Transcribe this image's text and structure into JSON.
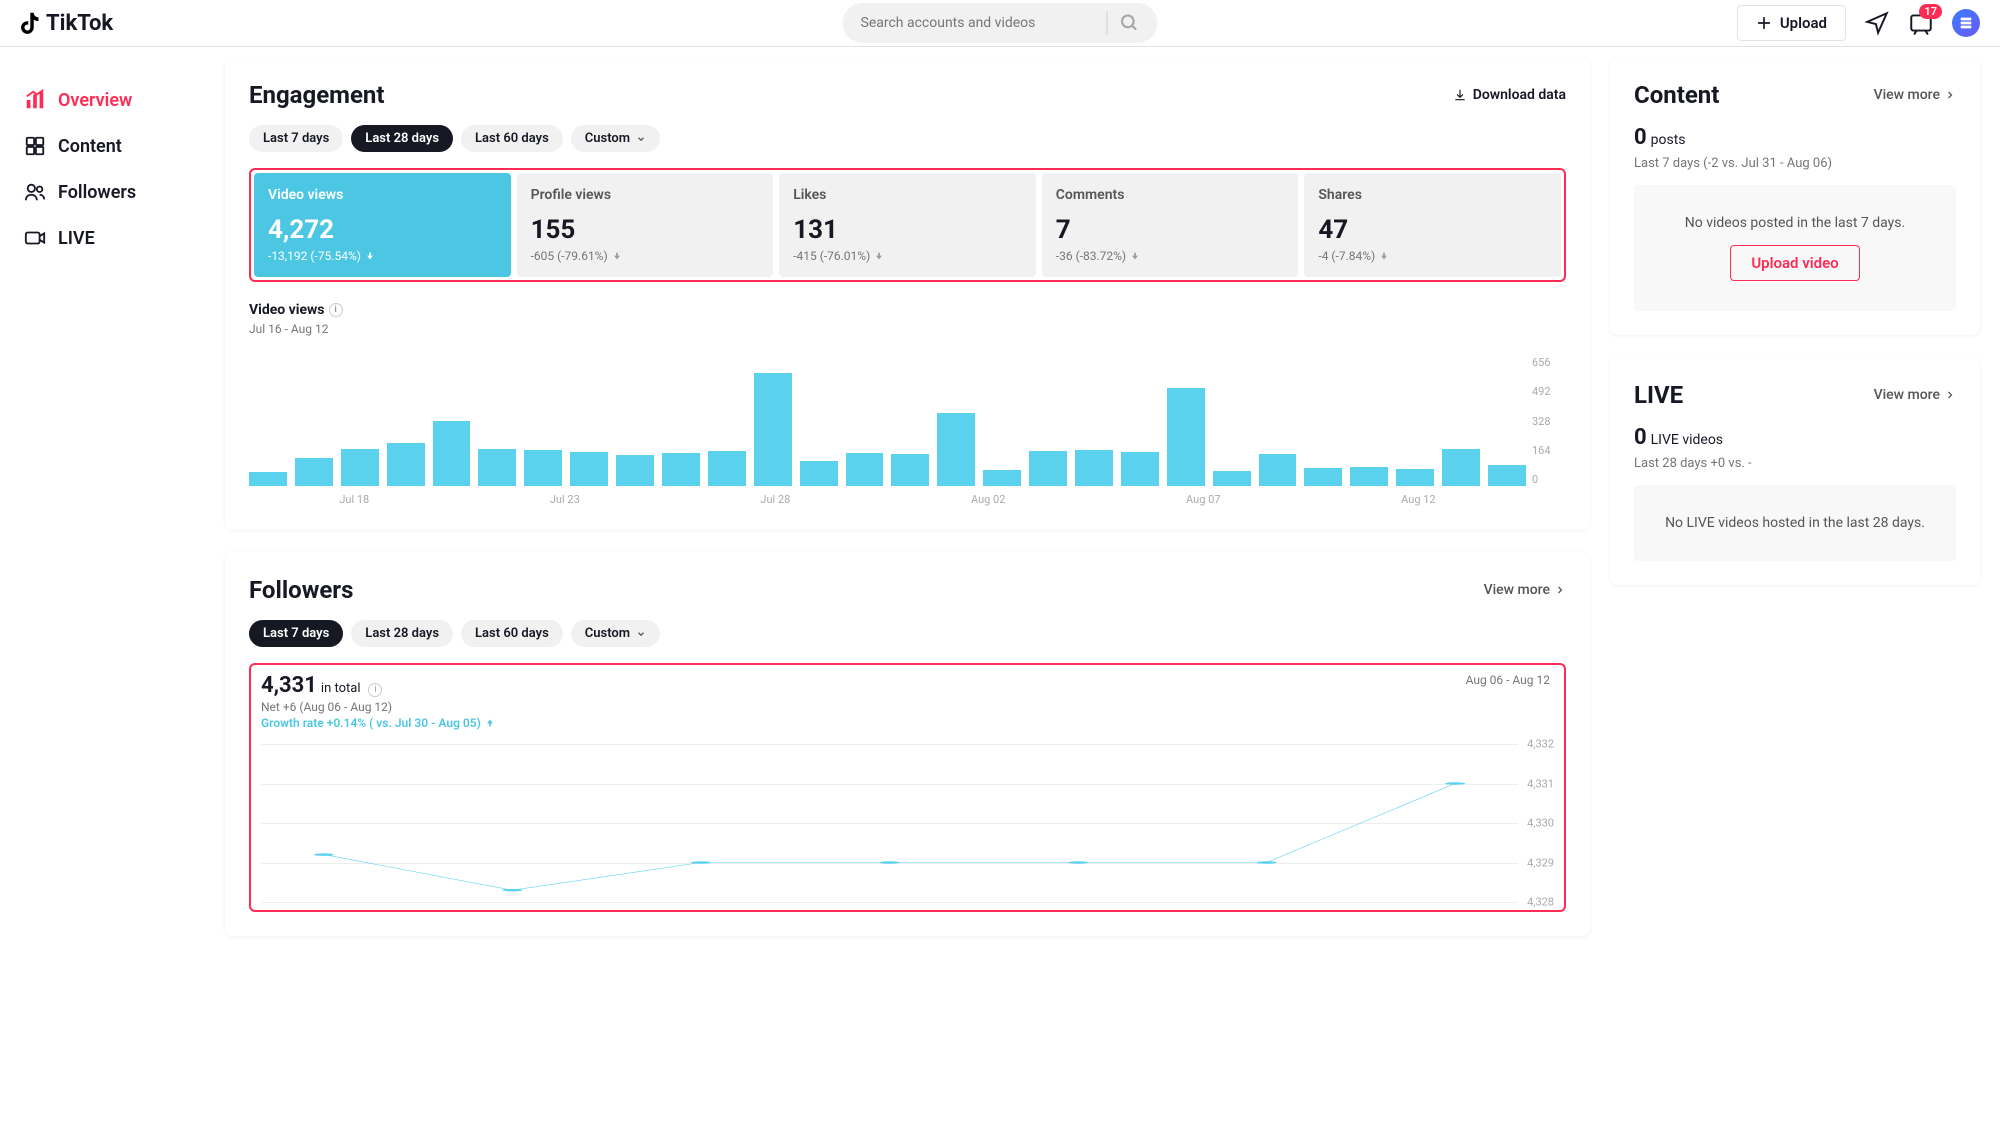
{
  "brand": "TikTok",
  "search": {
    "placeholder": "Search accounts and videos"
  },
  "header": {
    "upload": "Upload",
    "notif_count": "17"
  },
  "sidebar": {
    "items": [
      {
        "label": "Overview"
      },
      {
        "label": "Content"
      },
      {
        "label": "Followers"
      },
      {
        "label": "LIVE"
      }
    ]
  },
  "engagement": {
    "title": "Engagement",
    "download": "Download data",
    "pills": [
      "Last 7 days",
      "Last 28 days",
      "Last 60 days",
      "Custom"
    ],
    "metrics": [
      {
        "label": "Video views",
        "value": "4,272",
        "delta": "-13,192 (-75.54%)"
      },
      {
        "label": "Profile views",
        "value": "155",
        "delta": "-605 (-79.61%)"
      },
      {
        "label": "Likes",
        "value": "131",
        "delta": "-415 (-76.01%)"
      },
      {
        "label": "Comments",
        "value": "7",
        "delta": "-36 (-83.72%)"
      },
      {
        "label": "Shares",
        "value": "47",
        "delta": "-4 (-7.84%)"
      }
    ],
    "chart_title": "Video views",
    "chart_sub": "Jul 16 - Aug 12"
  },
  "chart_data": {
    "type": "bar",
    "title": "Video views",
    "ylabel": "",
    "ylim": [
      0,
      656
    ],
    "x_tick_labels": [
      "Jul 18",
      "Jul 23",
      "Jul 28",
      "Aug 02",
      "Aug 07",
      "Aug 12"
    ],
    "y_tick_labels": [
      "656",
      "492",
      "328",
      "164",
      "0"
    ],
    "values": [
      72,
      142,
      186,
      216,
      327,
      186,
      180,
      172,
      156,
      168,
      178,
      571,
      126,
      168,
      164,
      366,
      80,
      178,
      184,
      172,
      494,
      74,
      160,
      90,
      98,
      88,
      186,
      106
    ]
  },
  "followers": {
    "title": "Followers",
    "view_more": "View more",
    "pills": [
      "Last 7 days",
      "Last 28 days",
      "Last 60 days",
      "Custom"
    ],
    "total": "4,331",
    "total_label": "in total",
    "net": "Net +6 (Aug 06 - Aug 12)",
    "growth": "Growth rate +0.14% ( vs. Jul 30 - Aug 05)",
    "range": "Aug 06 - Aug 12",
    "line": {
      "y_labels": [
        "4,332",
        "4,331",
        "4,330",
        "4,329",
        "4,328"
      ],
      "points": [
        4329.2,
        4328.3,
        4329,
        4329,
        4329,
        4329,
        4331
      ]
    }
  },
  "content": {
    "title": "Content",
    "view_more": "View more",
    "count": "0",
    "count_label": "posts",
    "sub": "Last 7 days (-2 vs. Jul 31 - Aug 06)",
    "empty": "No videos posted in the last 7 days.",
    "upload_video": "Upload video"
  },
  "live": {
    "title": "LIVE",
    "view_more": "View more",
    "count": "0",
    "count_label": "LIVE videos",
    "sub": "Last 28 days +0 vs. -",
    "empty": "No LIVE videos hosted in the last 28 days."
  }
}
